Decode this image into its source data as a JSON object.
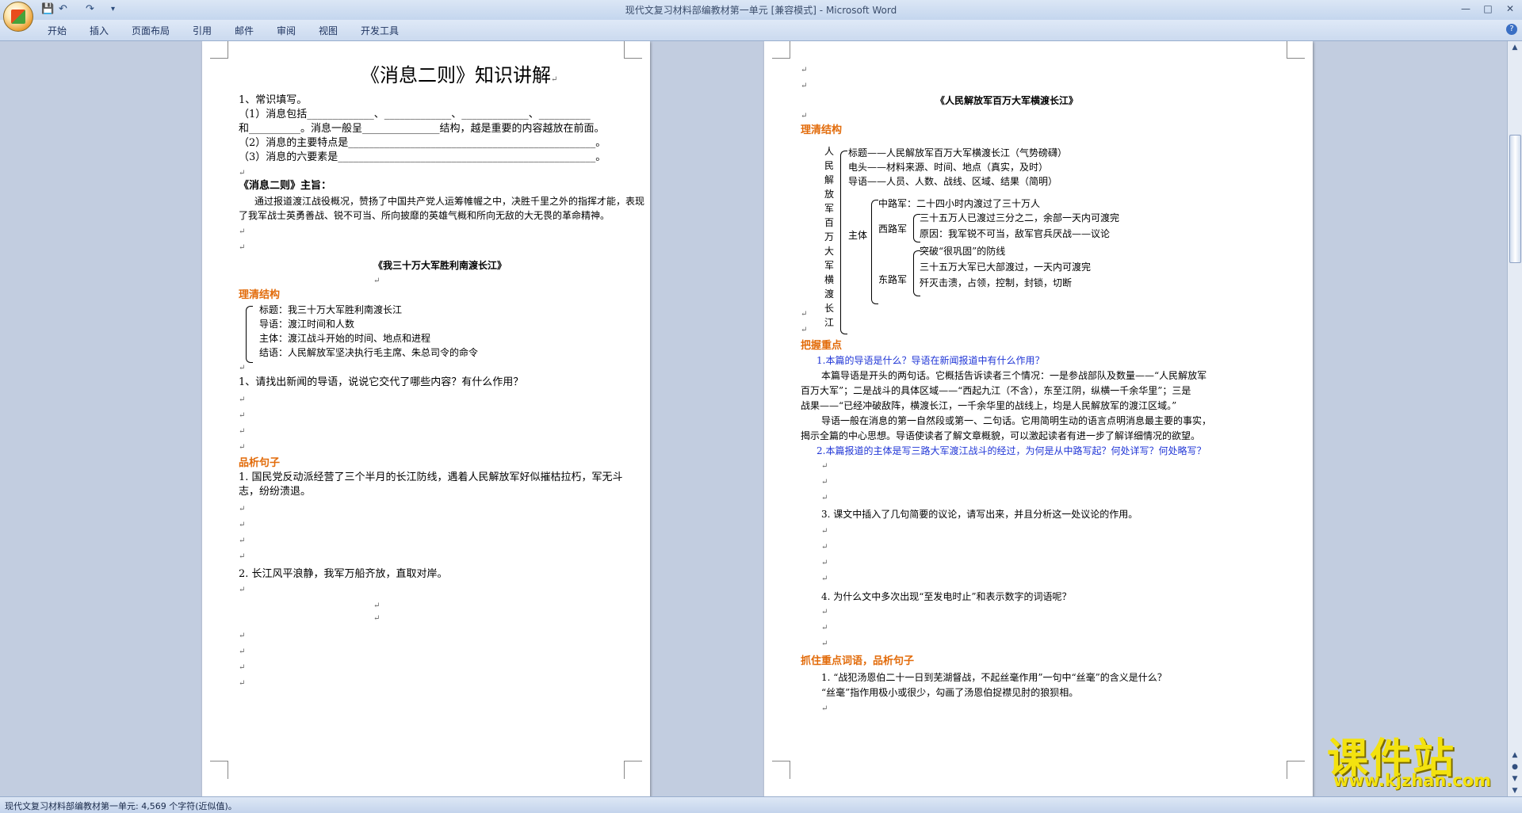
{
  "window": {
    "title": "现代文复习材料部编教材第一单元 [兼容模式]",
    "app": "Microsoft Word",
    "min": "—",
    "max": "□",
    "close": "✕"
  },
  "qat": {
    "save": "💾",
    "undo": "↶",
    "redo": "↷",
    "more": "▾"
  },
  "tabs": [
    "开始",
    "插入",
    "页面布局",
    "引用",
    "邮件",
    "审阅",
    "视图",
    "开发工具"
  ],
  "help": "?",
  "statusbar": {
    "text": "现代文复习材料部编教材第一单元: 4,569 个字符(近似值)。"
  },
  "watermark": {
    "main": "课件站",
    "url": "www.kjzhan.com"
  },
  "para_mark": "↵",
  "left": {
    "title": "《消息二则》知识讲解",
    "q1": "1、常识填写。",
    "q1a": "（1）消息包括_____________、_____________、_____________、__________",
    "q1b": "和__________。消息一般呈_______________结构，越是重要的内容越放在前面。",
    "q1c": "（2）消息的主要特点是________________________________________________。",
    "q1d": "（3）消息的六要素是__________________________________________________。",
    "theme_h": "《消息二则》主旨：",
    "theme_1": "通过报道渡江战役概况，赞扬了中国共产党人运筹帷幄之中，决胜千里之外的指挥才能，表现",
    "theme_2": "了我军战士英勇善战、锐不可当、所向披靡的英雄气概和所向无敌的大无畏的革命精神。",
    "art1": "《我三十万大军胜利南渡长江》",
    "struct_h": "理清结构",
    "s1": "标题：我三十万大军胜利南渡长江",
    "s2": "导语：渡江时间和人数",
    "s3": "主体：渡江战斗开始的时间、地点和进程",
    "s4": "结语：人民解放军坚决执行毛主席、朱总司令的命令",
    "ask1": "1、请找出新闻的导语，说说它交代了哪些内容？有什么作用？",
    "analyze_h": "品析句子",
    "a1_1": "1. 国民党反动派经营了三个半月的长江防线，遇着人民解放军好似摧枯拉朽，军无斗",
    "a1_2": "志，纷纷溃退。",
    "a2": "2. 长江风平浪静，我军万船齐放，直取对岸。"
  },
  "right": {
    "art2": "《人民解放军百万大军横渡长江》",
    "struct_h": "理清结构",
    "vertical": [
      "人",
      "民",
      "解",
      "放",
      "军",
      "百",
      "万",
      "大",
      "军",
      "横",
      "渡",
      "长",
      "江"
    ],
    "r1": "标题——人民解放军百万大军横渡长江（气势磅礴）",
    "r2": "电头——材料来源、时间、地点（真实，及时）",
    "r3": "导语——人员、人数、战线、区域、结果（简明）",
    "zhuti": "主体",
    "zhong": "中路军：二十四小时内渡过了三十万人",
    "xi": "西路军",
    "xi1": "三十五万人已渡过三分之二，余部一天内可渡完",
    "xi2": "原因：我军锐不可当，敌军官兵厌战——议论",
    "dong": "东路军",
    "dong1": "突破“很巩固”的防线",
    "dong2": "三十五万大军已大部渡过，一天内可渡完",
    "dong3": "歼灭击溃，占领，控制，封锁，切断",
    "key_h": "把握重点",
    "k1": "1.本篇的导语是什么？导语在新闻报道中有什么作用？",
    "k1a": "本篇导语是开头的两句话。它概括告诉读者三个情况：一是参战部队及数量——“人民解放军",
    "k1b": "百万大军”；二是战斗的具体区域——“西起九江（不含），东至江阴，纵横一千余华里”；三是",
    "k1c": "战果——“已经冲破敌阵，横渡长江，一千余华里的战线上，均是人民解放军的渡江区域。”",
    "k1d": "导语一般在消息的第一自然段或第一、二句话。它用简明生动的语言点明消息最主要的事实，",
    "k1e": "揭示全篇的中心思想。导语使读者了解文章概貌，可以激起读者有进一步了解详细情况的欲望。",
    "k2": "2.本篇报道的主体是写三路大军渡江战斗的经过，为何是从中路写起？何处详写？何处略写？",
    "k3": "3. 课文中插入了几句简要的议论，请写出来，并且分析这一处议论的作用。",
    "k4": "4. 为什么文中多次出现“至发电时止”和表示数字的词语呢？",
    "word_h": "抓住重点词语，品析句子",
    "w1a": "1. “战犯汤恩伯二十一日到芜湖督战，不起丝毫作用”一句中“丝毫”的含义是什么？",
    "w1b": "“丝毫”指作用极小或很少，勾画了汤恩伯捉襟见肘的狼狈相。"
  }
}
